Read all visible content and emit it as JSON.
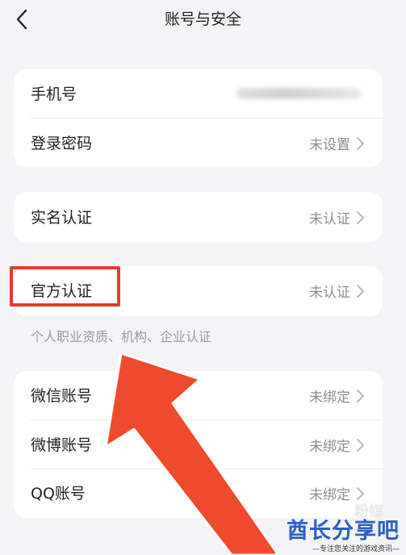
{
  "header": {
    "title": "账号与安全"
  },
  "group1": {
    "phone_label": "手机号",
    "password_label": "登录密码",
    "password_value": "未设置"
  },
  "group2": {
    "realname_label": "实名认证",
    "realname_value": "未认证"
  },
  "group3": {
    "official_label": "官方认证",
    "official_value": "未认证",
    "hint": "个人职业资质、机构、企业认证"
  },
  "group4": {
    "wechat_label": "微信账号",
    "wechat_value": "未绑定",
    "weibo_label": "微博账号",
    "weibo_value": "未绑定",
    "qq_label": "QQ账号",
    "qq_value": "未绑定"
  },
  "watermark": {
    "faint": "粉媒",
    "main": "酋长分享吧",
    "sub": "—专注您关注的游戏资讯—"
  },
  "colors": {
    "highlight": "#e63b2e",
    "arrow": "#f04a2c",
    "watermark": "#2c5fc4"
  },
  "icons": {
    "back": "chevron-left-icon",
    "row_arrow": "chevron-right-icon"
  }
}
